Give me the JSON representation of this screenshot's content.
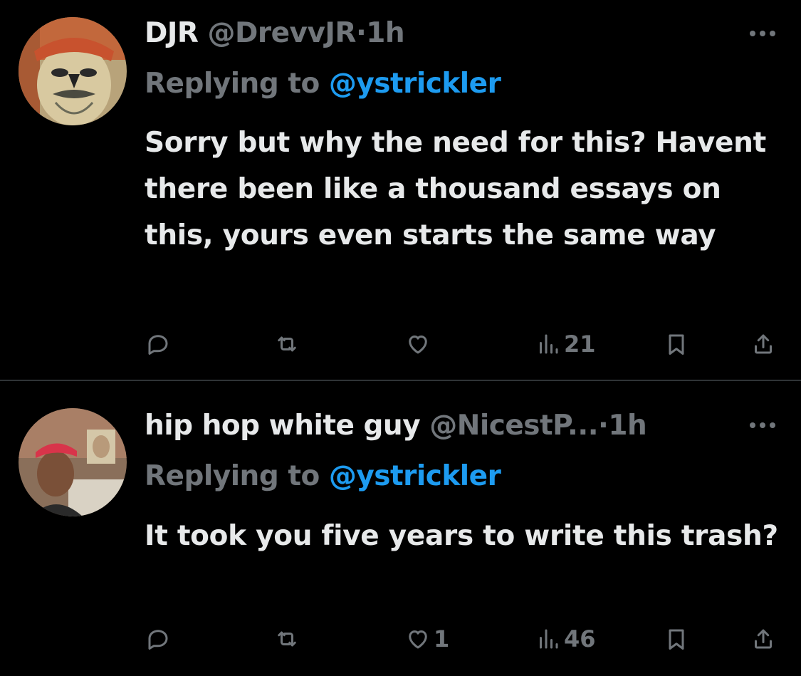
{
  "tweets": [
    {
      "display_name": "DJR",
      "handle": "@DrevvJR",
      "separator": "·",
      "time": "1h",
      "replying_prefix": "Replying to",
      "replying_to": "@ystrickler",
      "text": "Sorry but why the need for this? Havent there been like a thousand essays on this, yours even starts the same way",
      "reply_count": "",
      "retweet_count": "",
      "like_count": "",
      "view_count": "21"
    },
    {
      "display_name": "hip hop white guy",
      "handle": "@NicestP...",
      "separator": "·",
      "time": "1h",
      "replying_prefix": "Replying to",
      "replying_to": "@ystrickler",
      "text": "It took you five years to write this trash?",
      "reply_count": "",
      "retweet_count": "",
      "like_count": "1",
      "view_count": "46"
    }
  ],
  "icons": {
    "reply": "reply-icon",
    "retweet": "retweet-icon",
    "like": "heart-icon",
    "views": "views-icon",
    "bookmark": "bookmark-icon",
    "share": "share-icon",
    "more": "more-icon"
  },
  "colors": {
    "background": "#000000",
    "text": "#e7e9ea",
    "secondary": "#71767b",
    "accent": "#1d9bf0",
    "divider": "#2f3336"
  }
}
